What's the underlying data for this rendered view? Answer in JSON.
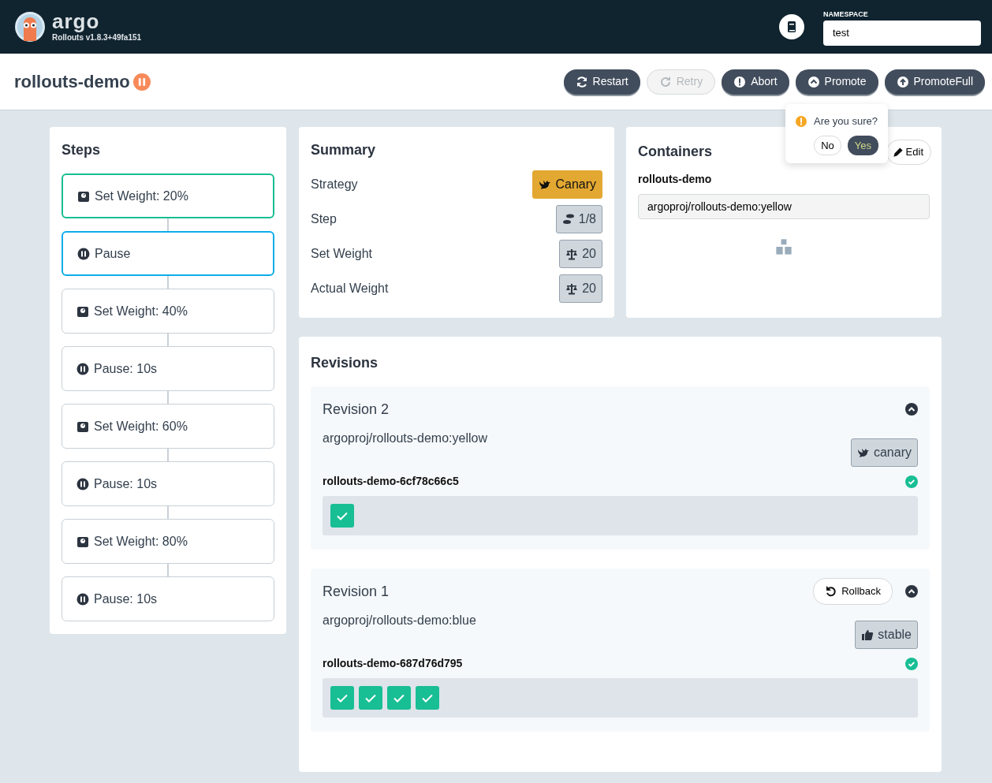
{
  "header": {
    "logo_text": "argo",
    "version": "Rollouts v1.8.3+49fa151",
    "namespace_label": "NAMESPACE",
    "namespace_value": "test"
  },
  "rollout": {
    "title": "rollouts-demo",
    "paused": true
  },
  "actions": [
    {
      "label": "Restart",
      "kind": "restart",
      "disabled": false
    },
    {
      "label": "Retry",
      "kind": "retry",
      "disabled": true
    },
    {
      "label": "Abort",
      "kind": "abort",
      "disabled": false
    },
    {
      "label": "Promote",
      "kind": "promote",
      "disabled": false
    },
    {
      "label": "PromoteFull",
      "kind": "promote-full",
      "disabled": false
    }
  ],
  "confirm": {
    "message": "Are you sure?",
    "no": "No",
    "yes": "Yes"
  },
  "steps": {
    "title": "Steps",
    "items": [
      {
        "kind": "weight",
        "label": "Set Weight: 20%",
        "completed": true,
        "selected": false
      },
      {
        "kind": "pause",
        "label": "Pause",
        "completed": false,
        "selected": true
      },
      {
        "kind": "weight",
        "label": "Set Weight: 40%",
        "completed": false,
        "selected": false
      },
      {
        "kind": "pause",
        "label": "Pause: 10s",
        "completed": false,
        "selected": false
      },
      {
        "kind": "weight",
        "label": "Set Weight: 60%",
        "completed": false,
        "selected": false
      },
      {
        "kind": "pause",
        "label": "Pause: 10s",
        "completed": false,
        "selected": false
      },
      {
        "kind": "weight",
        "label": "Set Weight: 80%",
        "completed": false,
        "selected": false
      },
      {
        "kind": "pause",
        "label": "Pause: 10s",
        "completed": false,
        "selected": false
      }
    ]
  },
  "summary": {
    "title": "Summary",
    "rows": [
      {
        "label": "Strategy",
        "value": "Canary",
        "kind": "canary"
      },
      {
        "label": "Step",
        "value": "1/8",
        "kind": "step"
      },
      {
        "label": "Set Weight",
        "value": "20",
        "kind": "weight"
      },
      {
        "label": "Actual Weight",
        "value": "20",
        "kind": "weight"
      }
    ]
  },
  "containers": {
    "title": "Containers",
    "edit": "Edit",
    "name": "rollouts-demo",
    "image": "argoproj/rollouts-demo:yellow"
  },
  "revisions": {
    "title": "Revisions",
    "items": [
      {
        "title": "Revision 2",
        "image": "argoproj/rollouts-demo:yellow",
        "tag": "canary",
        "kind": "canary",
        "replicaset": "rollouts-demo-6cf78c66c5",
        "pods": [
          {
            "ready": true
          }
        ]
      },
      {
        "title": "Revision 1",
        "rollback": "Rollback",
        "image": "argoproj/rollouts-demo:blue",
        "tag": "stable",
        "kind": "stable",
        "replicaset": "rollouts-demo-687d76d795",
        "pods": [
          {
            "ready": true
          },
          {
            "ready": true
          },
          {
            "ready": true
          },
          {
            "ready": true
          }
        ]
      }
    ]
  }
}
